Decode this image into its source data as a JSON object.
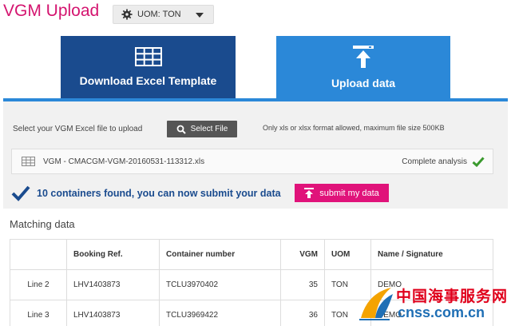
{
  "header": {
    "title": "VGM Upload",
    "uom_select": {
      "label": "UOM: TON",
      "icon": "gear-icon"
    }
  },
  "tabs": [
    {
      "label": "Download Excel Template",
      "icon": "grid-icon",
      "active": false
    },
    {
      "label": "Upload data",
      "icon": "upload-icon",
      "active": true
    }
  ],
  "upload": {
    "select_label": "Select your VGM Excel file to upload",
    "select_button": "Select File",
    "format_note": "Only xls or xlsx format allowed, maximum file size 500KB",
    "file_name": "VGM - CMACGM-VGM-20160531-113312.xls",
    "analysis_status": "Complete analysis",
    "found_message": "10 containers found, you can now submit your data",
    "submit_button": "submit my data"
  },
  "matching": {
    "title": "Matching data",
    "columns": [
      "",
      "Booking Ref.",
      "Container number",
      "VGM",
      "UOM",
      "Name / Signature"
    ],
    "rows": [
      {
        "line": "Line 2",
        "booking": "LHV1403873",
        "container": "TCLU3970402",
        "vgm": "35",
        "uom": "TON",
        "name": "DEMO"
      },
      {
        "line": "Line 3",
        "booking": "LHV1403873",
        "container": "TCLU3969422",
        "vgm": "36",
        "uom": "TON",
        "name": "DEMO"
      }
    ]
  },
  "watermark": {
    "cn_text": "中国海事服务网",
    "en_text": "cnss.com.cn"
  },
  "colors": {
    "brand_pink": "#d4146f",
    "dark_blue": "#1a4b8e",
    "light_blue": "#2b88d8",
    "submit_pink": "#e0137a",
    "success_green": "#3a9a2e"
  }
}
